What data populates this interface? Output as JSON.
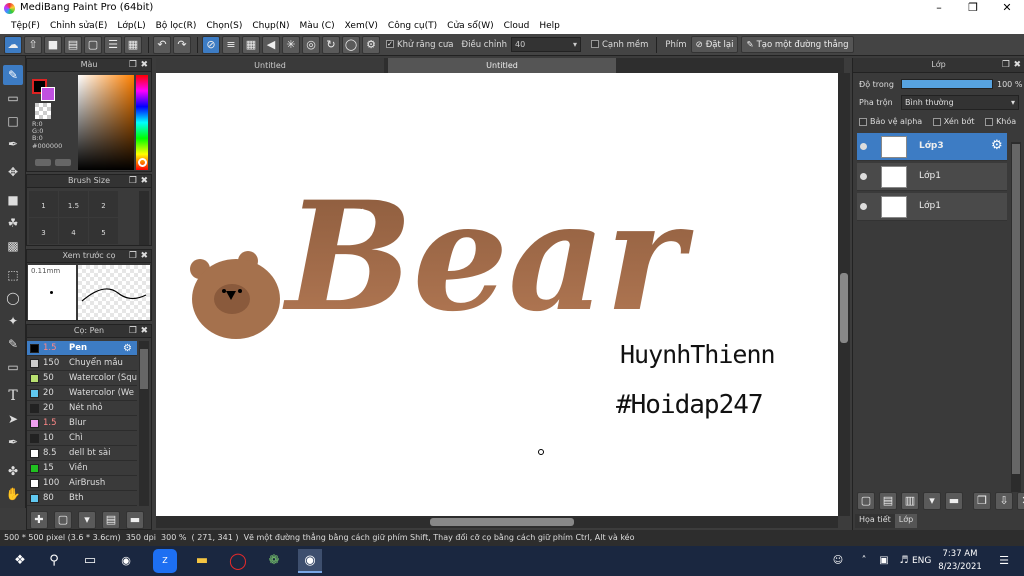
{
  "window": {
    "title": "MediBang Paint Pro (64bit)"
  },
  "menu": [
    "Tệp(F)",
    "Chỉnh sửa(E)",
    "Lớp(L)",
    "Bộ lọc(R)",
    "Chọn(S)",
    "Chụp(N)",
    "Màu (C)",
    "Xem(V)",
    "Công cụ(T)",
    "Cửa sổ(W)",
    "Cloud",
    "Help"
  ],
  "toolbar": {
    "antialias_label": "Khử răng cưa",
    "adjust_label": "Điều chỉnh",
    "adjust_value": "40",
    "edge_label": "Cạnh mềm",
    "key_label": "Phím",
    "reset_label": "Đặt lại",
    "line_label": "Tạo một đường thẳng"
  },
  "color_panel": {
    "title": "Màu",
    "r": "R:0",
    "g": "G:0",
    "b": "B:0",
    "hex": "#000000"
  },
  "brush_size": {
    "title": "Brush Size",
    "sizes": [
      "1",
      "1.5",
      "2",
      "3",
      "4",
      "5"
    ]
  },
  "preview": {
    "title": "Xem trước cọ",
    "size": "0.11mm"
  },
  "brush_panel": {
    "title": "Cọ: Pen",
    "items": [
      {
        "size": "1.5",
        "name": "Pen",
        "color": "#000000"
      },
      {
        "size": "150",
        "name": "Chuyển mầu",
        "color": "#cccccc"
      },
      {
        "size": "50",
        "name": "Watercolor (Squ",
        "color": "#b8e070"
      },
      {
        "size": "20",
        "name": "Watercolor (We",
        "color": "#60c8f0"
      },
      {
        "size": "20",
        "name": "Nét nhỏ",
        "color": "#222222"
      },
      {
        "size": "1.5",
        "name": "Blur",
        "color": "#f0a0f0"
      },
      {
        "size": "10",
        "name": "Chì",
        "color": "#222222"
      },
      {
        "size": "8.5",
        "name": "dell bt sài",
        "color": "#ffffff"
      },
      {
        "size": "15",
        "name": "Viền",
        "color": "#20c020"
      },
      {
        "size": "100",
        "name": "AirBrush",
        "color": "#ffffff"
      },
      {
        "size": "80",
        "name": "Bth",
        "color": "#60c8f0"
      }
    ]
  },
  "tabs": [
    "Untitled",
    "Untitled"
  ],
  "canvas": {
    "title_art": "Bear",
    "signature": "HuynhThienn",
    "hashtag": "#Hoidap247"
  },
  "layer_panel": {
    "title": "Lớp",
    "opacity_label": "Độ trong",
    "opacity_value": "100 %",
    "opacity_fraction": 1.0,
    "blend_label": "Pha trộn",
    "blend_value": "Bình thường",
    "protect_alpha": "Bảo vệ alpha",
    "clip": "Xén bớt",
    "lock": "Khóa",
    "layers": [
      "Lớp3",
      "Lớp1",
      "Lớp1"
    ],
    "bottom_tabs": [
      "Họa tiết",
      "Lớp"
    ]
  },
  "status": {
    "size": "500 * 500 pixel",
    "cm": "(3.6 * 3.6cm)",
    "dpi": "350 dpi",
    "zoom": "300 %",
    "coords": "( 271, 341 )",
    "hint": "Vẽ một đường thẳng bằng cách giữ phím Shift, Thay đổi cỡ cọ bằng cách giữ phím Ctrl, Alt và kéo"
  },
  "taskbar": {
    "lang": "ENG",
    "time": "7:37 AM",
    "date": "8/23/2021"
  }
}
